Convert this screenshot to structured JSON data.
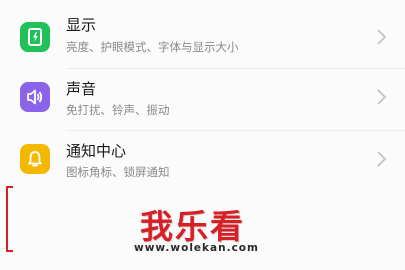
{
  "settings": {
    "items": [
      {
        "title": "显示",
        "subtitle": "亮度、护眼模式、字体与显示大小",
        "icon": "display-icon",
        "icon_color": "#21c15a"
      },
      {
        "title": "声音",
        "subtitle": "免打扰、铃声、振动",
        "icon": "speaker-icon",
        "icon_color": "#8a63e8"
      },
      {
        "title": "通知中心",
        "subtitle": "图标角标、锁屏通知",
        "icon": "bell-icon",
        "icon_color": "#f5b800"
      }
    ]
  },
  "watermark": {
    "logo_text": "我乐看",
    "url": "www.wolekan.com"
  }
}
